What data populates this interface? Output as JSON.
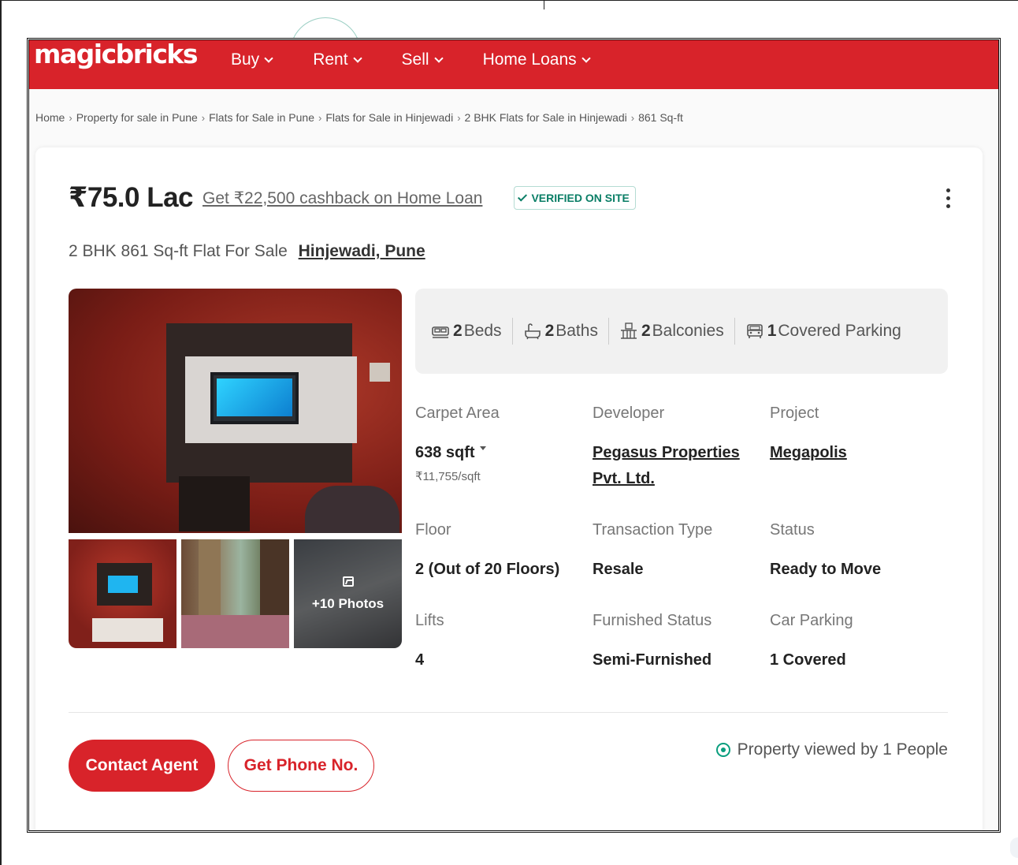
{
  "header": {
    "logo": "magicbricks",
    "brand_color": "#d8232a",
    "nav": [
      {
        "label": "Buy"
      },
      {
        "label": "Rent"
      },
      {
        "label": "Sell"
      },
      {
        "label": "Home Loans"
      }
    ]
  },
  "breadcrumb": [
    "Home",
    "Property for sale in Pune",
    "Flats for Sale in Pune",
    "Flats for Sale in Hinjewadi",
    "2 BHK Flats for Sale in Hinjewadi",
    "861 Sq-ft"
  ],
  "listing": {
    "price": "₹75.0 Lac",
    "cashback": "Get ₹22,500 cashback on Home Loan",
    "verified": "VERIFIED ON SITE",
    "title": "2 BHK 861 Sq-ft Flat For Sale",
    "location": "Hinjewadi, Pune"
  },
  "gallery": {
    "more_photos": "+10 Photos"
  },
  "features": [
    {
      "icon": "bed-icon",
      "num": "2",
      "label": "Beds"
    },
    {
      "icon": "bath-icon",
      "num": "2",
      "label": "Baths"
    },
    {
      "icon": "balcony-icon",
      "num": "2",
      "label": "Balconies"
    },
    {
      "icon": "car-icon",
      "num": "1",
      "label": "Covered Parking"
    }
  ],
  "details": {
    "carpet_area": {
      "label": "Carpet Area",
      "value": "638 sqft",
      "sub": "₹11,755/sqft"
    },
    "developer": {
      "label": "Developer",
      "value_line1": "Pegasus Properties",
      "value_line2": "Pvt. Ltd."
    },
    "project": {
      "label": "Project",
      "value": "Megapolis"
    },
    "floor": {
      "label": "Floor",
      "value": "2 (Out of 20 Floors)"
    },
    "transaction": {
      "label": "Transaction Type",
      "value": "Resale"
    },
    "status": {
      "label": "Status",
      "value": "Ready to Move"
    },
    "lifts": {
      "label": "Lifts",
      "value": "4"
    },
    "furnished": {
      "label": "Furnished Status",
      "value": "Semi-Furnished"
    },
    "car_parking": {
      "label": "Car Parking",
      "value": "1 Covered"
    }
  },
  "actions": {
    "contact_agent": "Contact Agent",
    "get_phone": "Get Phone No.",
    "views": "Property viewed by 1 People"
  }
}
